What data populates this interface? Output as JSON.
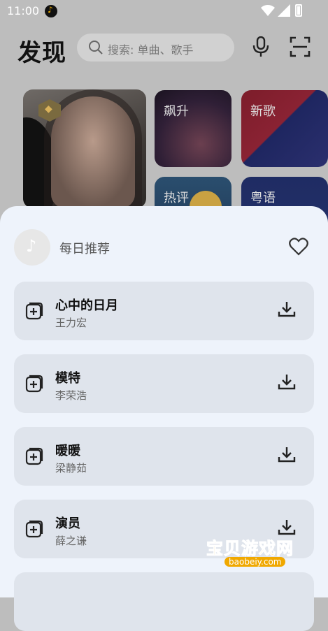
{
  "status": {
    "time": "11:00"
  },
  "header": {
    "title": "发现",
    "search_placeholder": "搜索: 单曲、歌手"
  },
  "cards": {
    "small": [
      {
        "label": "飙升"
      },
      {
        "label": "新歌"
      },
      {
        "label": "热评"
      },
      {
        "label": "粤语"
      }
    ]
  },
  "sheet": {
    "title": "每日推荐",
    "songs": [
      {
        "title": "心中的日月",
        "artist": "王力宏"
      },
      {
        "title": "模特",
        "artist": "李荣浩"
      },
      {
        "title": "暖暖",
        "artist": "梁静茹"
      },
      {
        "title": "演员",
        "artist": "薛之谦"
      }
    ]
  },
  "watermark": {
    "text": "宝贝游戏网",
    "sub": "baobeiy.com"
  },
  "colors": {
    "sheet_bg": "#eef3fb",
    "row_bg": "#dfe4ec",
    "accent": "#f0a800"
  }
}
